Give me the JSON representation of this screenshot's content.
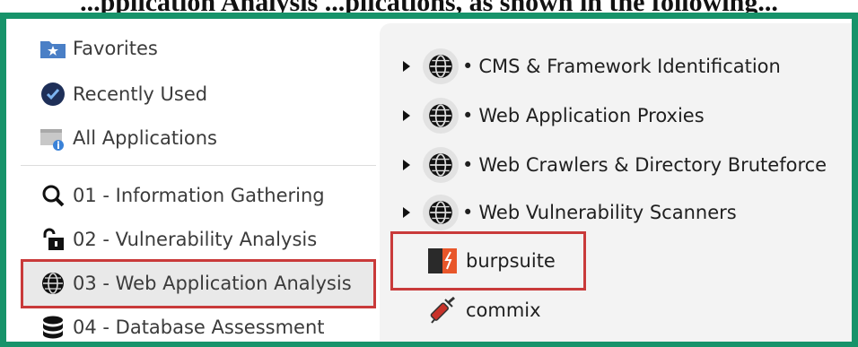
{
  "caption": "...pplication Analysis  ...plications, as shown in the following...",
  "sidebar": {
    "items": [
      {
        "label": "Favorites",
        "icon": "favorites-folder-icon"
      },
      {
        "label": "Recently Used",
        "icon": "recently-used-icon"
      },
      {
        "label": "All Applications",
        "icon": "all-applications-icon"
      },
      {
        "label": "01 - Information Gathering",
        "icon": "magnifier-icon"
      },
      {
        "label": "02 - Vulnerability Analysis",
        "icon": "padlock-icon"
      },
      {
        "label": "03 - Web Application Analysis",
        "icon": "globe-icon",
        "selected": true
      },
      {
        "label": "04 - Database Assessment",
        "icon": "database-icon"
      }
    ]
  },
  "content": {
    "categories": [
      {
        "label": "CMS & Framework Identification",
        "bullet": "•"
      },
      {
        "label": "Web Application Proxies",
        "bullet": "•"
      },
      {
        "label": "Web Crawlers & Directory Bruteforce",
        "bullet": "•"
      },
      {
        "label": "Web Vulnerability Scanners",
        "bullet": "•"
      }
    ],
    "apps": [
      {
        "label": "burpsuite",
        "icon": "burpsuite-icon",
        "highlighted": true
      },
      {
        "label": "commix",
        "icon": "commix-syringe-icon"
      }
    ]
  },
  "colors": {
    "frame": "#17936a",
    "highlight": "#c93a3a",
    "selected_bg": "#e9e9e9",
    "pane_bg": "#f3f3f3"
  }
}
